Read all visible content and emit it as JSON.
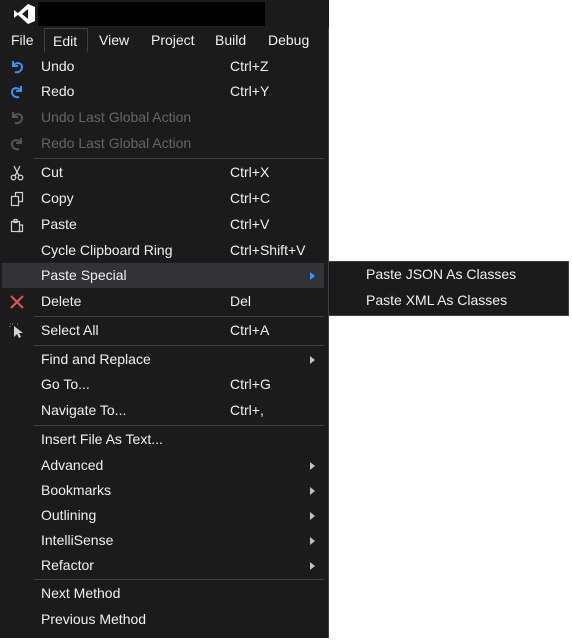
{
  "menubar": {
    "items": [
      "File",
      "Edit",
      "View",
      "Project",
      "Build",
      "Debug"
    ],
    "active_index": 1
  },
  "edit_menu": {
    "undo": {
      "label": "Undo",
      "shortcut": "Ctrl+Z",
      "icon": "undo-icon"
    },
    "redo": {
      "label": "Redo",
      "shortcut": "Ctrl+Y",
      "icon": "redo-icon"
    },
    "undo_global": {
      "label": "Undo Last Global Action",
      "icon": "undo-global-icon",
      "disabled": true
    },
    "redo_global": {
      "label": "Redo Last Global Action",
      "icon": "redo-global-icon",
      "disabled": true
    },
    "cut": {
      "label": "Cut",
      "shortcut": "Ctrl+X",
      "icon": "scissors-icon"
    },
    "copy": {
      "label": "Copy",
      "shortcut": "Ctrl+C",
      "icon": "copy-icon"
    },
    "paste": {
      "label": "Paste",
      "shortcut": "Ctrl+V",
      "icon": "paste-icon"
    },
    "cycle_clipboard": {
      "label": "Cycle Clipboard Ring",
      "shortcut": "Ctrl+Shift+V"
    },
    "paste_special": {
      "label": "Paste Special",
      "has_submenu": true,
      "highlighted": true
    },
    "delete": {
      "label": "Delete",
      "shortcut": "Del",
      "icon": "delete-x-icon"
    },
    "select_all": {
      "label": "Select All",
      "shortcut": "Ctrl+A",
      "icon": "select-all-icon"
    },
    "find_replace": {
      "label": "Find and Replace",
      "has_submenu": true
    },
    "go_to": {
      "label": "Go To...",
      "shortcut": "Ctrl+G"
    },
    "navigate_to": {
      "label": "Navigate To...",
      "shortcut": "Ctrl+,"
    },
    "insert_file": {
      "label": "Insert File As Text..."
    },
    "advanced": {
      "label": "Advanced",
      "has_submenu": true
    },
    "bookmarks": {
      "label": "Bookmarks",
      "has_submenu": true
    },
    "outlining": {
      "label": "Outlining",
      "has_submenu": true
    },
    "intellisense": {
      "label": "IntelliSense",
      "has_submenu": true
    },
    "refactor": {
      "label": "Refactor",
      "has_submenu": true
    },
    "next_method": {
      "label": "Next Method"
    },
    "previous_method": {
      "label": "Previous Method"
    }
  },
  "paste_special_submenu": {
    "items": [
      "Paste JSON As Classes",
      "Paste XML As Classes"
    ]
  },
  "colors": {
    "background": "#1b1b1c",
    "highlight": "#333337",
    "accent_blue": "#3794ff",
    "delete_red": "#e05252",
    "disabled_text": "#656565",
    "separator": "#3f3f46"
  }
}
